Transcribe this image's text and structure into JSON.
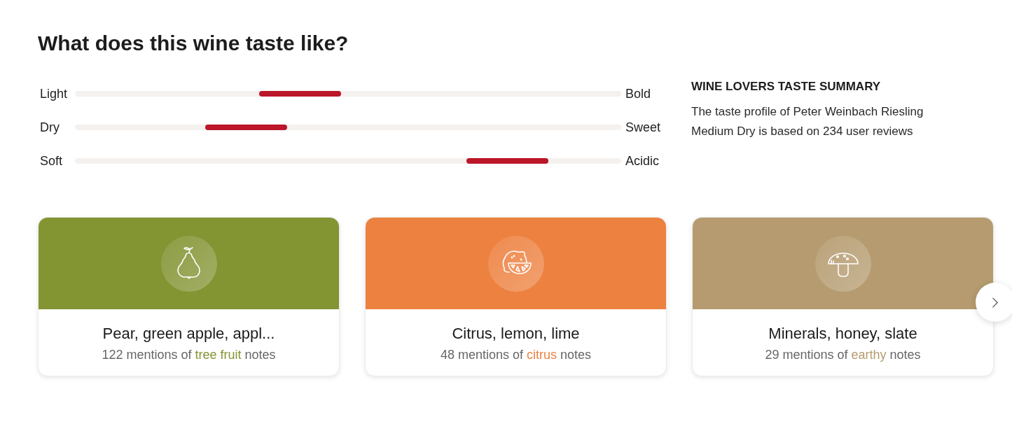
{
  "title": "What does this wine taste like?",
  "tastes": [
    {
      "left": "Light",
      "right": "Bold",
      "level": 0.412
    },
    {
      "left": "Dry",
      "right": "Sweet",
      "level": 0.313
    },
    {
      "left": "Soft",
      "right": "Acidic",
      "level": 0.792
    }
  ],
  "summary": {
    "heading": "WINE LOVERS TASTE SUMMARY",
    "text": "The taste profile of Peter Weinbach Riesling Medium Dry is based on 234 user reviews"
  },
  "cards": [
    {
      "kind": "pear",
      "color": "#839433",
      "title": "Pear, green apple, appl...",
      "count": "122 mentions of",
      "category": "tree fruit",
      "suffix": "notes"
    },
    {
      "kind": "citrus",
      "color": "#ed8140",
      "title": "Citrus, lemon, lime",
      "count": "48 mentions of",
      "category": "citrus",
      "suffix": "notes"
    },
    {
      "kind": "mushroom",
      "color": "#b59b6f",
      "title": "Minerals, honey, slate",
      "count": "29 mentions of",
      "category": "earthy",
      "suffix": "notes"
    }
  ]
}
